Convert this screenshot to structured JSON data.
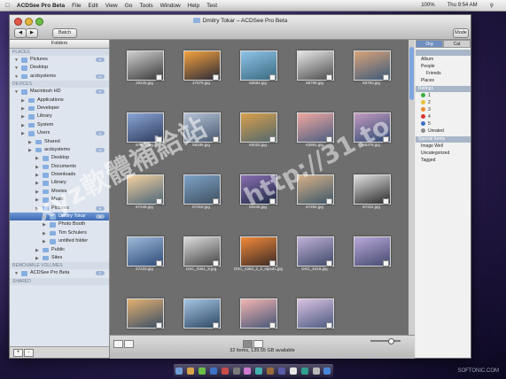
{
  "menubar": {
    "apple": "",
    "app": "ACDSee Pro Beta",
    "menus": [
      "File",
      "Edit",
      "View",
      "Go",
      "Tools",
      "Window",
      "Help",
      "Test"
    ],
    "right": [
      "100%",
      "Thu 9:54 AM"
    ]
  },
  "window": {
    "title": "Dmitry Tokar – ACDSee Pro Beta",
    "batch_label": "Batch",
    "toolbar_right": "Mode"
  },
  "left_panel": {
    "header": "Folders",
    "sections": {
      "places": "PLACES",
      "devices": "DEVICES",
      "removable": "REMOVABLE VOLUMES",
      "shared": "SHARED"
    },
    "places": [
      {
        "label": "Pictures",
        "badge": "5"
      },
      {
        "label": "Desktop",
        "badge": ""
      },
      {
        "label": "acdsystems",
        "badge": "11"
      }
    ],
    "devices": [
      {
        "label": "Macintosh HD",
        "badge": "9",
        "level": 0
      },
      {
        "label": "Applications",
        "badge": "",
        "level": 1
      },
      {
        "label": "Developer",
        "badge": "",
        "level": 1
      },
      {
        "label": "Library",
        "badge": "",
        "level": 1
      },
      {
        "label": "System",
        "badge": "",
        "level": 1
      },
      {
        "label": "Users",
        "badge": "5",
        "level": 1
      },
      {
        "label": "Shared",
        "badge": "",
        "level": 2
      },
      {
        "label": "acdsystems",
        "badge": "11",
        "level": 2
      },
      {
        "label": "Desktop",
        "badge": "",
        "level": 3
      },
      {
        "label": "Documents",
        "badge": "",
        "level": 3
      },
      {
        "label": "Downloads",
        "badge": "",
        "level": 3
      },
      {
        "label": "Library",
        "badge": "",
        "level": 3
      },
      {
        "label": "Movies",
        "badge": "",
        "level": 3
      },
      {
        "label": "Music",
        "badge": "",
        "level": 3
      },
      {
        "label": "Pictures",
        "badge": "6",
        "level": 3
      },
      {
        "label": "Dmitry Tokar",
        "badge": "6",
        "level": 4,
        "selected": true
      },
      {
        "label": "Photo Booth",
        "badge": "",
        "level": 4
      },
      {
        "label": "Tim Schulers",
        "badge": "",
        "level": 4
      },
      {
        "label": "untitled folder",
        "badge": "",
        "level": 4
      },
      {
        "label": "Public",
        "badge": "",
        "level": 3
      },
      {
        "label": "Sites",
        "badge": "",
        "level": 3
      }
    ],
    "removable": [
      {
        "label": "ACDSee Pro Beta",
        "badge": "2"
      }
    ]
  },
  "browser": {
    "thumbnails": [
      {
        "caption": "29245.jpg",
        "tone": "#cfcfcf,#3a3a3a"
      },
      {
        "caption": "47878.jpg",
        "tone": "#f3a23c,#2b2a3a"
      },
      {
        "caption": "56584.jpg",
        "tone": "#8fc3e8,#3a6a80"
      },
      {
        "caption": "58799.jpg",
        "tone": "#e6e6e6,#4d4d4d"
      },
      {
        "caption": "59783.jpg",
        "tone": "#d9a37a,#3d5a7a"
      },
      {
        "caption": "57829.jpg",
        "tone": "#8aa6d6,#2f3c5c"
      },
      {
        "caption": "58189.jpg",
        "tone": "#b5c2d6,#4a5a70"
      },
      {
        "caption": "60020.jpg",
        "tone": "#d9a04b,#51676e"
      },
      {
        "caption": "63891.jpg",
        "tone": "#f0a8a0,#4a5d80"
      },
      {
        "caption": "65378.jpg",
        "tone": "#c49ac0,#2e4a72"
      },
      {
        "caption": "67248.jpg",
        "tone": "#f5d2a0,#4b6479"
      },
      {
        "caption": "67319.jpg",
        "tone": "#7ea3c8,#3e4f60"
      },
      {
        "caption": "62246.jpg",
        "tone": "#8a6fb0,#1e2a45"
      },
      {
        "caption": "67282.jpg",
        "tone": "#d7b28a,#3c5568"
      },
      {
        "caption": "67322.jpg",
        "tone": "#e0e0e0,#2a2a2a"
      },
      {
        "caption": "67233.jpg",
        "tone": "#9fb9d8,#2d4c78"
      },
      {
        "caption": "DSC_0361_8.jpg",
        "tone": "#dcdcdc,#444444"
      },
      {
        "caption": "DSC_4363_2_2_stpsd1.jpg",
        "tone": "#f28a3a,#3b2a26"
      },
      {
        "caption": "DSC_5319.jpg",
        "tone": "#c0b0d8,#3d4968"
      },
      {
        "caption": "",
        "tone": "#b9a8d9,#444a70"
      },
      {
        "caption": "",
        "tone": "#e2b070,#3a4e66"
      },
      {
        "caption": "",
        "tone": "#a7c4e2,#2c4864"
      },
      {
        "caption": "",
        "tone": "#f2b4b0,#465678"
      },
      {
        "caption": "",
        "tone": "#d9c2e2,#4c5a80"
      }
    ],
    "status": "32 items, 139.55 GB available"
  },
  "right_panel": {
    "tabs": [
      "Org",
      "Cat"
    ],
    "people_section": "",
    "people": [
      "Album",
      "People",
      "Friends",
      "Places"
    ],
    "ratings_section": "Ratings",
    "ratings": [
      {
        "label": "1",
        "color": "#3fae3f"
      },
      {
        "label": "2",
        "color": "#e8c23a"
      },
      {
        "label": "3",
        "color": "#e98b2c"
      },
      {
        "label": "4",
        "color": "#d9382e"
      },
      {
        "label": "5",
        "color": "#3b6fc9"
      },
      {
        "label": "Unrated",
        "color": "#8a8a8a"
      }
    ],
    "special_section": "Special Items",
    "special": [
      "Image Well",
      "Uncategorized",
      "Tagged"
    ]
  },
  "watermark": {
    "text1": "xyz軟體補給站",
    "text2": "http://31.to",
    "corner": "SOFTONIC.COM"
  },
  "dock": {
    "colors": [
      "#6f9ad6",
      "#d6a24a",
      "#6bbd45",
      "#3d73c8",
      "#c94b4b",
      "#7a7a7a",
      "#d07ad0",
      "#44b0b0",
      "#9b6b3a",
      "#5a5aa8",
      "#e6e6e6",
      "#2f9e8f",
      "#b9b9b9",
      "#4a86d6"
    ]
  }
}
